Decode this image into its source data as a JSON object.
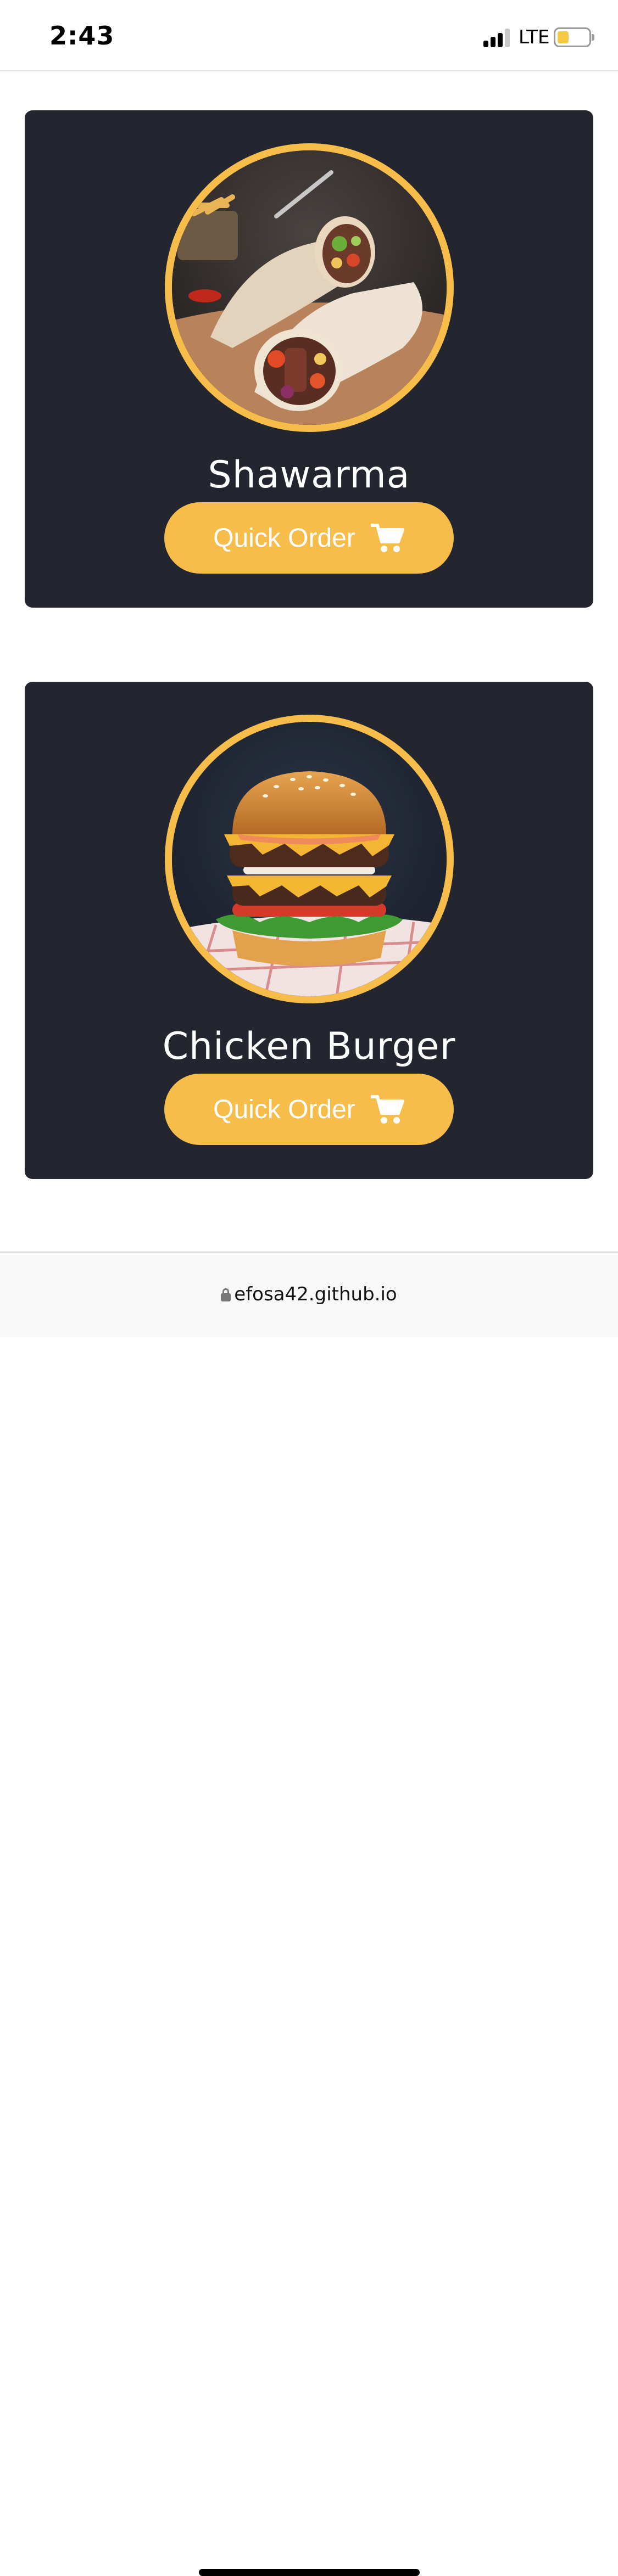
{
  "status_bar": {
    "time": "2:43",
    "network": "LTE",
    "signal_bars_active": 3,
    "battery_level": 0.35
  },
  "menu_items": [
    {
      "name": "Shawarma",
      "button_label": "Quick Order",
      "photo": "shawarma-wrap-photo",
      "button_icon": "cart-icon"
    },
    {
      "name": "Chicken Burger",
      "button_label": "Quick Order",
      "photo": "burger-photo",
      "button_icon": "cart-icon"
    }
  ],
  "browser": {
    "url": "efosa42.github.io",
    "secure_icon": "lock-icon"
  },
  "colors": {
    "card_background": "#23262f",
    "accent": "#f6bd4b",
    "page_background": "#ffffff",
    "battery_fill": "#f6c943"
  }
}
